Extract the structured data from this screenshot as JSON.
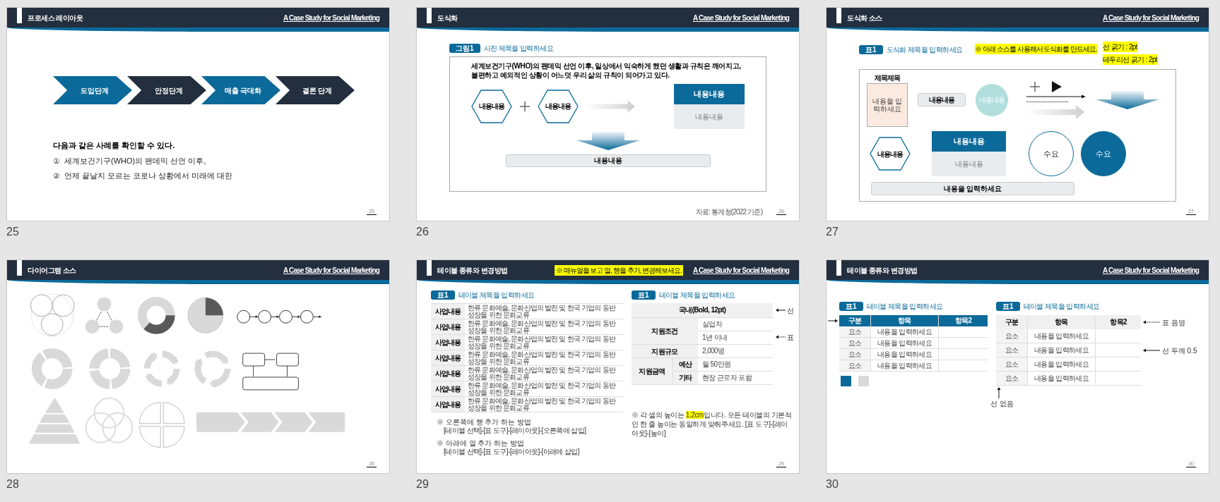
{
  "slides": [
    {
      "kind": "process",
      "number": "25",
      "page": "25",
      "title": "프로세스 레이아웃",
      "subtitle": "A Case Study for Social Marketing",
      "steps": [
        {
          "label": "도입단계",
          "color": "#0b6a99"
        },
        {
          "label": "안정단계",
          "color": "#232e3e"
        },
        {
          "label": "매출 극대화",
          "color": "#0b6a99"
        },
        {
          "label": "결론 단계",
          "color": "#232e3e"
        }
      ],
      "heading": "다음과 같은 사례를 확인할 수 있다.",
      "items": [
        {
          "marker": "①",
          "text": "세계보건기구(WHO)의 팬데믹 선언 이후,"
        },
        {
          "marker": "②",
          "text": "언제 끝날지 모르는 코로나 상황에서 미래에 대한"
        }
      ]
    },
    {
      "kind": "figure",
      "number": "26",
      "page": "26",
      "title": "도식화",
      "subtitle": "A Case Study for Social Marketing",
      "tag": "그림1",
      "caption": "사진 제목을 입력하세요",
      "paragraph": "세계보건기구(WHO)의 팬데믹 선언 이후,  일상에서 익숙하게 했던 생활과 규칙은 깨어지고, 불편하고 예외적인 상황이 어느덧 우리 삶의 규칙이 되어가고 있다.",
      "hexagons": [
        "내용내용",
        "내용내용"
      ],
      "card": {
        "head": "내용내용",
        "body": "내용내용"
      },
      "bar": "내용내용",
      "source": "자료: 통계청(2022 기준)"
    },
    {
      "kind": "source",
      "number": "27",
      "page": "27",
      "title": "도식화 소스",
      "subtitle": "A Case Study for Social Marketing",
      "tag": "표1",
      "caption": "도식화 제목을 입력하세요",
      "note": "※ 아래 소스를 사용해서 도식화를 만드세요.",
      "specs": [
        "선 굵기 : 2pt",
        "테두리선 굵기 : 2pt"
      ],
      "box_title": "제목제목",
      "box_text": "내용을 입력하세요",
      "pill": "내용내용",
      "bubble": "내용내용",
      "hexagon": "내용내용",
      "card": {
        "head": "내용내용",
        "body": "내용내용"
      },
      "circles": [
        {
          "label": "수요",
          "filled": false
        },
        {
          "label": "수요",
          "filled": true
        }
      ],
      "bar": "내용을 입력하세요"
    },
    {
      "kind": "diagrams",
      "number": "28",
      "page": "28",
      "title": "다이어그램 소스",
      "subtitle": "A Case Study for Social Marketing"
    },
    {
      "kind": "table_guide",
      "number": "29",
      "page": "29",
      "title": "테이블 종류와 변경방법",
      "subtitle": "A Case Study for Social Marketing",
      "header_note": "※ 매뉴얼을 보고 열, 행을 추가, 변경해보세요.",
      "left": {
        "tag": "표1",
        "caption": "테이블 제목을 입력하세요",
        "rows": [
          {
            "label": "사업내용",
            "text": "한류 문화예술, 문화산업의 발전 및 한국 기업의 동반 성장을 위한 문화교류"
          },
          {
            "label": "사업내용",
            "text": "한류 문화예술, 문화산업의 발전 및 한국 기업의 동반 성장을 위한 문화교류"
          },
          {
            "label": "사업내용",
            "text": "한류 문화예술, 문화산업의 발전 및 한국 기업의 동반 성장을 위한 문화교류"
          },
          {
            "label": "사업내용",
            "text": "한류 문화예술, 문화산업의 발전 및 한국 기업의 동반 성장을 위한 문화교류"
          },
          {
            "label": "사업내용",
            "text": "한류 문화예술, 문화산업의 발전 및 한국 기업의 동반 성장을 위한 문화교류"
          },
          {
            "label": "사업내용",
            "text": "한류 문화예술, 문화산업의 발전 및 한국 기업의 동반 성장을 위한 문화교류"
          },
          {
            "label": "사업내용",
            "text": "한류 문화예술, 문화산업의 발전 및 한국 기업의 동반 성장을 위한 문화교류"
          }
        ]
      },
      "right": {
        "tag": "표1",
        "caption": "테이블 제목을 입력하세요",
        "header": "국내(Bold, 12pt)",
        "rows": [
          {
            "kind": "list",
            "label": "지원조건",
            "values": [
              "실업자",
              "1년 이내"
            ]
          },
          {
            "kind": "list",
            "label": "지원규모",
            "values": [
              "2,000명"
            ]
          },
          {
            "kind": "sub",
            "label": "지원금액",
            "subs": [
              {
                "label": "예산",
                "value": "월 50만원"
              },
              {
                "label": "기타",
                "value": "현장 근로자 포함"
              }
            ]
          }
        ]
      },
      "annotations": [
        "선",
        "표"
      ],
      "tips": [
        {
          "title": "※ 오른쪽에 행 추가 하는 방법",
          "path": "[테이블 선택]-[표 도구]-[레이아웃]-[오른쪽에 삽입]"
        },
        {
          "title": "※ 아래에 열 추가 하는 방법",
          "path": "[테이블 선택]-[표 도구]-[레이아웃]-[아래에 삽입]"
        }
      ],
      "cell_note": {
        "before": "※ 각 셀의 높이는 ",
        "highlight": "1.2cm",
        "after": "입니다. 모든 테이블의 기본적인 한 줄 높이는 동일하게 맞춰주세요. [표 도구]-[레이아웃]-[높이]"
      }
    },
    {
      "kind": "table_styles",
      "number": "30",
      "page": "30",
      "title": "테이블 종류와 변경방법",
      "subtitle": "A Case Study for Social Marketing",
      "tables": [
        {
          "tag": "표1",
          "caption": "테이블 제목을 입력하세요",
          "columns": [
            "구분",
            "항목",
            "항목2"
          ],
          "rows": [
            [
              "요소",
              "내용을 입력하세요"
            ],
            [
              "요소",
              "내용을 입력하세요"
            ],
            [
              "요소",
              "내용을 입력하세요"
            ],
            [
              "요소",
              "내용을 입력하세요"
            ]
          ]
        },
        {
          "tag": "표1",
          "caption": "테이블 제목을 입력하세요",
          "columns": [
            "구분",
            "항목",
            "항목2"
          ],
          "rows": [
            [
              "요소",
              "내용을 입력하세요"
            ],
            [
              "요소",
              "내용을 입력하세요"
            ],
            [
              "요소",
              "내용을 입력하세요"
            ],
            [
              "요소",
              "내용을 입력하세요"
            ]
          ]
        }
      ],
      "swatches": [
        {
          "color": "#0b6a99"
        },
        {
          "color": "#d9d9d9"
        }
      ],
      "annotations": [
        {
          "kind": "dotted",
          "text": "표 음영"
        },
        {
          "kind": "solid",
          "text": "선 두께 0.5"
        },
        {
          "kind": "up",
          "text": "선 없음"
        }
      ]
    }
  ]
}
